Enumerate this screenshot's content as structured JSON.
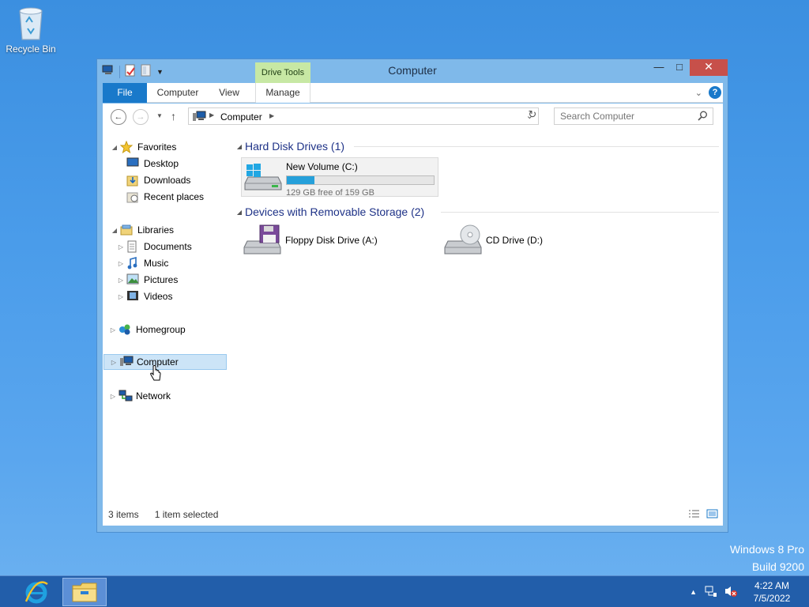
{
  "desktop": {
    "recycle_bin_label": "Recycle Bin",
    "watermark_line1": "Windows 8 Pro",
    "watermark_line2": "Build 9200"
  },
  "window": {
    "title": "Computer",
    "contextual_tab": "Drive Tools",
    "ribbon_tabs": {
      "file": "File",
      "computer": "Computer",
      "view": "View",
      "manage": "Manage"
    },
    "help_glyph": "?"
  },
  "navigation": {
    "address": "Computer",
    "search_placeholder": "Search Computer"
  },
  "tree": {
    "favorites": "Favorites",
    "desktop": "Desktop",
    "downloads": "Downloads",
    "recent_places": "Recent places",
    "libraries": "Libraries",
    "documents": "Documents",
    "music": "Music",
    "pictures": "Pictures",
    "videos": "Videos",
    "homegroup": "Homegroup",
    "computer": "Computer",
    "network": "Network"
  },
  "content": {
    "hard_disk_group": "Hard Disk Drives (1)",
    "removable_group": "Devices with Removable Storage (2)",
    "drive_c": {
      "name": "New Volume (C:)",
      "free_text": "129 GB free of 159 GB",
      "used_fraction": 0.19
    },
    "floppy": {
      "name": "Floppy Disk Drive (A:)"
    },
    "cd": {
      "name": "CD Drive (D:)"
    }
  },
  "status": {
    "item_count": "3 items",
    "selection": "1 item selected"
  },
  "taskbar": {
    "time": "4:22 AM",
    "date": "7/5/2022"
  },
  "colors": {
    "accent": "#1979ca",
    "contextual_tab": "#c7e8a4",
    "close_button": "#c7504a",
    "progress_fill": "#26a0da",
    "group_header": "#1e3287"
  }
}
